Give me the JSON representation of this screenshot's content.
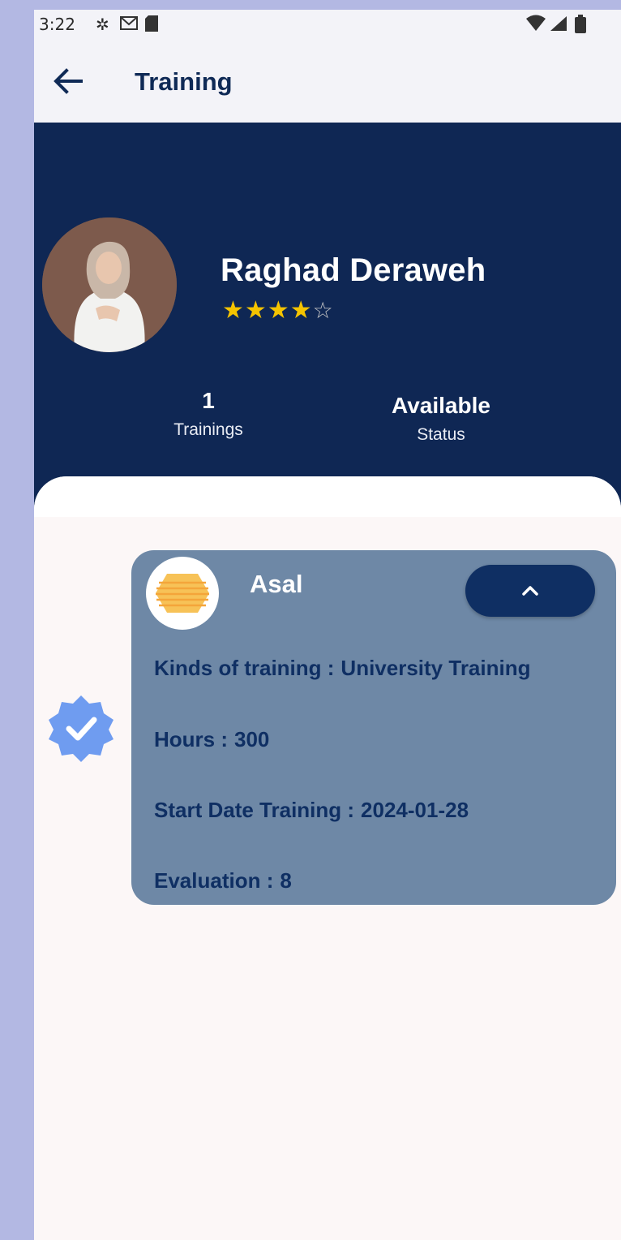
{
  "status_bar": {
    "time": "3:22",
    "icons": [
      "gear-icon",
      "gmail-icon",
      "sim-card-icon",
      "wifi-icon",
      "cellular-icon",
      "battery-icon"
    ]
  },
  "app_bar": {
    "title": "Training",
    "back_icon": "arrow-left-icon"
  },
  "profile": {
    "name": "Raghad Deraweh",
    "rating": 4,
    "rating_max": 5,
    "stats": {
      "trainings": {
        "value": "1",
        "label": "Trainings"
      },
      "status": {
        "value": "Available",
        "label": "Status"
      }
    }
  },
  "training_card": {
    "company": "Asal",
    "expanded": true,
    "collapse_icon": "chevron-up-icon",
    "kinds_label": "Kinds of training :",
    "kinds_value": "University Training",
    "hours_label": "Hours :",
    "hours_value": "300",
    "start_label": "Start Date Training  :",
    "start_value": "2024-01-28",
    "evaluation_label": "Evaluation :",
    "evaluation_value": "8",
    "verified_icon": "verified-badge-icon"
  },
  "colors": {
    "header_bg": "#0f2754",
    "card_bg": "#6e88a6",
    "accent_dark": "#0f2f63",
    "star": "#f5c400",
    "badge": "#6f9cf0"
  }
}
